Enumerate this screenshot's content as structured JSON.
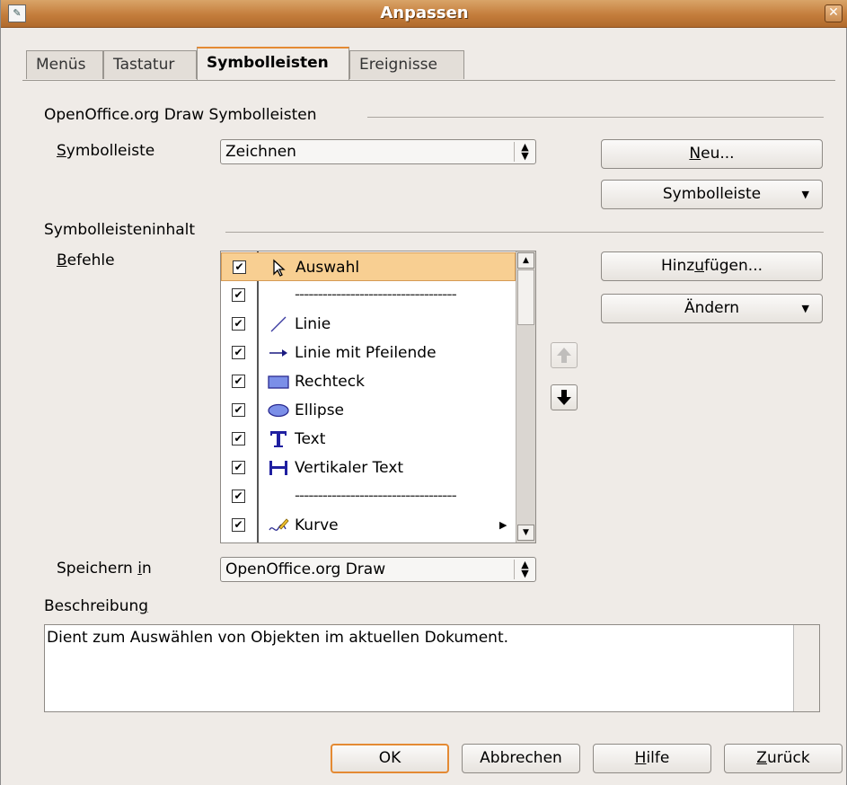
{
  "window": {
    "title": "Anpassen",
    "close_symbol": "✕"
  },
  "tabs": [
    {
      "label": "Menüs",
      "active": false
    },
    {
      "label": "Tastatur",
      "active": false
    },
    {
      "label": "Symbolleisten",
      "active": true
    },
    {
      "label": "Ereignisse",
      "active": false
    }
  ],
  "group_title": "OpenOffice.org Draw Symbolleisten",
  "toolbar": {
    "label_first": "S",
    "label_rest": "ymbolleiste",
    "value": "Zeichnen",
    "new_first": "N",
    "new_rest": "eu...",
    "menu_button": "Symbolleiste",
    "dropdown_arrow": "▼"
  },
  "content_section": "Symbolleisteninhalt",
  "commands": {
    "label_first": "B",
    "label_rest": "efehle",
    "items": [
      {
        "label": "Auswahl",
        "checked": true,
        "selected": true,
        "icon": "pointer-icon",
        "separator": false
      },
      {
        "label": "-----------------------------------",
        "checked": true,
        "selected": false,
        "icon": "",
        "separator": true
      },
      {
        "label": "Linie",
        "checked": true,
        "selected": false,
        "icon": "line-icon",
        "separator": false
      },
      {
        "label": "Linie mit Pfeilende",
        "checked": true,
        "selected": false,
        "icon": "arrow-line-icon",
        "separator": false
      },
      {
        "label": "Rechteck",
        "checked": true,
        "selected": false,
        "icon": "rectangle-icon",
        "separator": false
      },
      {
        "label": "Ellipse",
        "checked": true,
        "selected": false,
        "icon": "ellipse-icon",
        "separator": false
      },
      {
        "label": "Text",
        "checked": true,
        "selected": false,
        "icon": "text-icon",
        "separator": false
      },
      {
        "label": "Vertikaler Text",
        "checked": true,
        "selected": false,
        "icon": "vertical-text-icon",
        "separator": false
      },
      {
        "label": "-----------------------------------",
        "checked": true,
        "selected": false,
        "icon": "",
        "separator": true
      },
      {
        "label": "Kurve",
        "checked": true,
        "selected": false,
        "icon": "curve-icon",
        "separator": false,
        "submenu": true
      }
    ],
    "check_mark": "✔",
    "submenu_arrow": "▶",
    "scroll_up": "▲",
    "scroll_down": "▼"
  },
  "buttons": {
    "add_pre": "Hinz",
    "add_u": "u",
    "add_post": "fügen...",
    "modify": "Ändern",
    "dropdown_arrow": "▼"
  },
  "save_in": {
    "label_pre": "Speichern ",
    "label_u": "i",
    "label_post": "n",
    "value": "OpenOffice.org Draw"
  },
  "description": {
    "label_pre": "Beschreibun",
    "label_u": "g",
    "text": "Dient zum Auswählen von Objekten im aktuellen Dokument."
  },
  "footer": {
    "ok": "OK",
    "cancel": "Abbrechen",
    "help_u": "H",
    "help_rest": "ilfe",
    "reset_u": "Z",
    "reset_rest": "urück"
  },
  "colors": {
    "accent": "#e48a33",
    "selection": "#f8cf92",
    "titlebar": "#c47d3c"
  }
}
